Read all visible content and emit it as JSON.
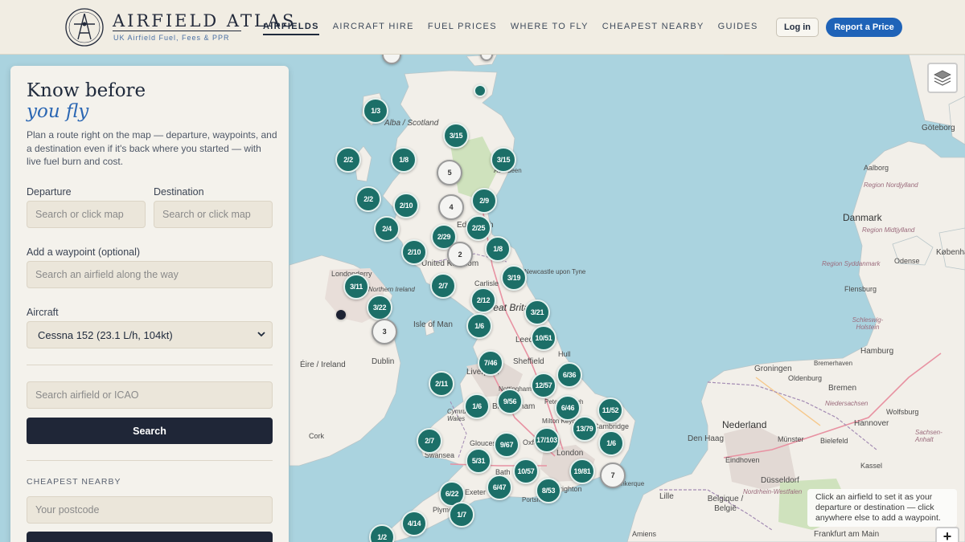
{
  "header": {
    "brand_name": "AIRFIELD ATLAS",
    "brand_tagline": "UK Airfield Fuel, Fees & PPR",
    "nav": [
      {
        "label": "AIRFIELDS",
        "active": true
      },
      {
        "label": "AIRCRAFT HIRE",
        "active": false
      },
      {
        "label": "FUEL PRICES",
        "active": false
      },
      {
        "label": "WHERE TO FLY",
        "active": false
      },
      {
        "label": "CHEAPEST NEARBY",
        "active": false
      },
      {
        "label": "GUIDES",
        "active": false
      }
    ],
    "login_label": "Log in",
    "report_label": "Report a Price"
  },
  "panel": {
    "heading_line1": "Know before",
    "heading_line2": "you fly",
    "intro": "Plan a route right on the map — departure, waypoints, and a destination even if it's back where you started — with live fuel burn and cost.",
    "departure_label": "Departure",
    "departure_placeholder": "Search or click map",
    "destination_label": "Destination",
    "destination_placeholder": "Search or click map",
    "waypoint_label": "Add a waypoint (optional)",
    "waypoint_placeholder": "Search an airfield along the way",
    "aircraft_label": "Aircraft",
    "aircraft_value": "Cessna 152 (23.1 L/h, 104kt)",
    "search_placeholder": "Search airfield or ICAO",
    "search_button": "Search",
    "cheapest_caption": "CHEAPEST NEARBY",
    "postcode_placeholder": "Your postcode"
  },
  "map": {
    "tooltip": "Click an airfield to set it as your departure or destination — click anywhere else to add a waypoint.",
    "zoom_in": "+",
    "colors": {
      "cluster": "#1c6f68",
      "water": "#aad3df",
      "land": "#f2efe9"
    },
    "clusters": [
      {
        "label": "1/3",
        "style": "green"
      },
      {
        "label": "3/15",
        "style": "green"
      },
      {
        "label": "2/2",
        "style": "green"
      },
      {
        "label": "1/8",
        "style": "green"
      },
      {
        "label": "5",
        "style": "white"
      },
      {
        "label": "3/15",
        "style": "green"
      },
      {
        "label": "2/2",
        "style": "green"
      },
      {
        "label": "2/10",
        "style": "green"
      },
      {
        "label": "4",
        "style": "white"
      },
      {
        "label": "2/9",
        "style": "green"
      },
      {
        "label": "2/4",
        "style": "green"
      },
      {
        "label": "2/29",
        "style": "green"
      },
      {
        "label": "2/25",
        "style": "green"
      },
      {
        "label": "2/10",
        "style": "green"
      },
      {
        "label": "2",
        "style": "white"
      },
      {
        "label": "1/8",
        "style": "green"
      },
      {
        "label": "3/11",
        "style": "green"
      },
      {
        "label": "2/7",
        "style": "green"
      },
      {
        "label": "3/19",
        "style": "green"
      },
      {
        "label": "3/22",
        "style": "green"
      },
      {
        "label": "2/12",
        "style": "green"
      },
      {
        "label": "3/21",
        "style": "green"
      },
      {
        "label": "3",
        "style": "white"
      },
      {
        "label": "1/6",
        "style": "green"
      },
      {
        "label": "10/51",
        "style": "green"
      },
      {
        "label": "7/46",
        "style": "green"
      },
      {
        "label": "6/36",
        "style": "green"
      },
      {
        "label": "2/11",
        "style": "green"
      },
      {
        "label": "12/57",
        "style": "green"
      },
      {
        "label": "9/56",
        "style": "green"
      },
      {
        "label": "1/6",
        "style": "green"
      },
      {
        "label": "6/46",
        "style": "green"
      },
      {
        "label": "11/52",
        "style": "green"
      },
      {
        "label": "13/79",
        "style": "green"
      },
      {
        "label": "2/7",
        "style": "green"
      },
      {
        "label": "17/103",
        "style": "green"
      },
      {
        "label": "9/67",
        "style": "green"
      },
      {
        "label": "1/6",
        "style": "green"
      },
      {
        "label": "5/31",
        "style": "green"
      },
      {
        "label": "10/57",
        "style": "green"
      },
      {
        "label": "19/81",
        "style": "green"
      },
      {
        "label": "7",
        "style": "white"
      },
      {
        "label": "6/47",
        "style": "green"
      },
      {
        "label": "8/53",
        "style": "green"
      },
      {
        "label": "6/22",
        "style": "green"
      },
      {
        "label": "1/7",
        "style": "green"
      },
      {
        "label": "4/14",
        "style": "green"
      },
      {
        "label": "1/2",
        "style": "green"
      }
    ],
    "places": [
      "Alba / Scotland",
      "Aberdeen",
      "Edinburgh",
      "United Kingdom",
      "Londonderry",
      "Northern Ireland",
      "Carlisle",
      "Newcastle upon Tyne",
      "Great Britain",
      "Isle of Man",
      "Leeds",
      "Hull",
      "Éire / Ireland",
      "Dublin",
      "Liverpool",
      "Sheffield",
      "Nottingham",
      "Birmingham",
      "Peterborough",
      "Milton Keynes",
      "Cambridge",
      "Cymru / Wales",
      "Cork",
      "Gloucester",
      "Oxford",
      "London",
      "Swansea",
      "Bath",
      "Brighton",
      "Portsmouth",
      "Exeter",
      "Plymouth",
      "Göteborg",
      "Aalborg",
      "Danmark",
      "Region Nordjylland",
      "Region Midtjylland",
      "Region Syddanmark",
      "Odense",
      "København",
      "Flensburg",
      "Schleswig-Holstein",
      "Hamburg",
      "Bremen",
      "Bremerhaven",
      "Oldenburg",
      "Groningen",
      "Niedersachsen",
      "Nederland",
      "Den Haag",
      "Hannover",
      "Wolfsburg",
      "Bielefeld",
      "Münster",
      "Sachsen-Anhalt",
      "Eindhoven",
      "Kassel",
      "Düsseldorf",
      "Lille",
      "Belgique / België",
      "Nordrhein-Westfalen",
      "Amiens",
      "Frankfurt am Main",
      "Dunkerque"
    ]
  }
}
